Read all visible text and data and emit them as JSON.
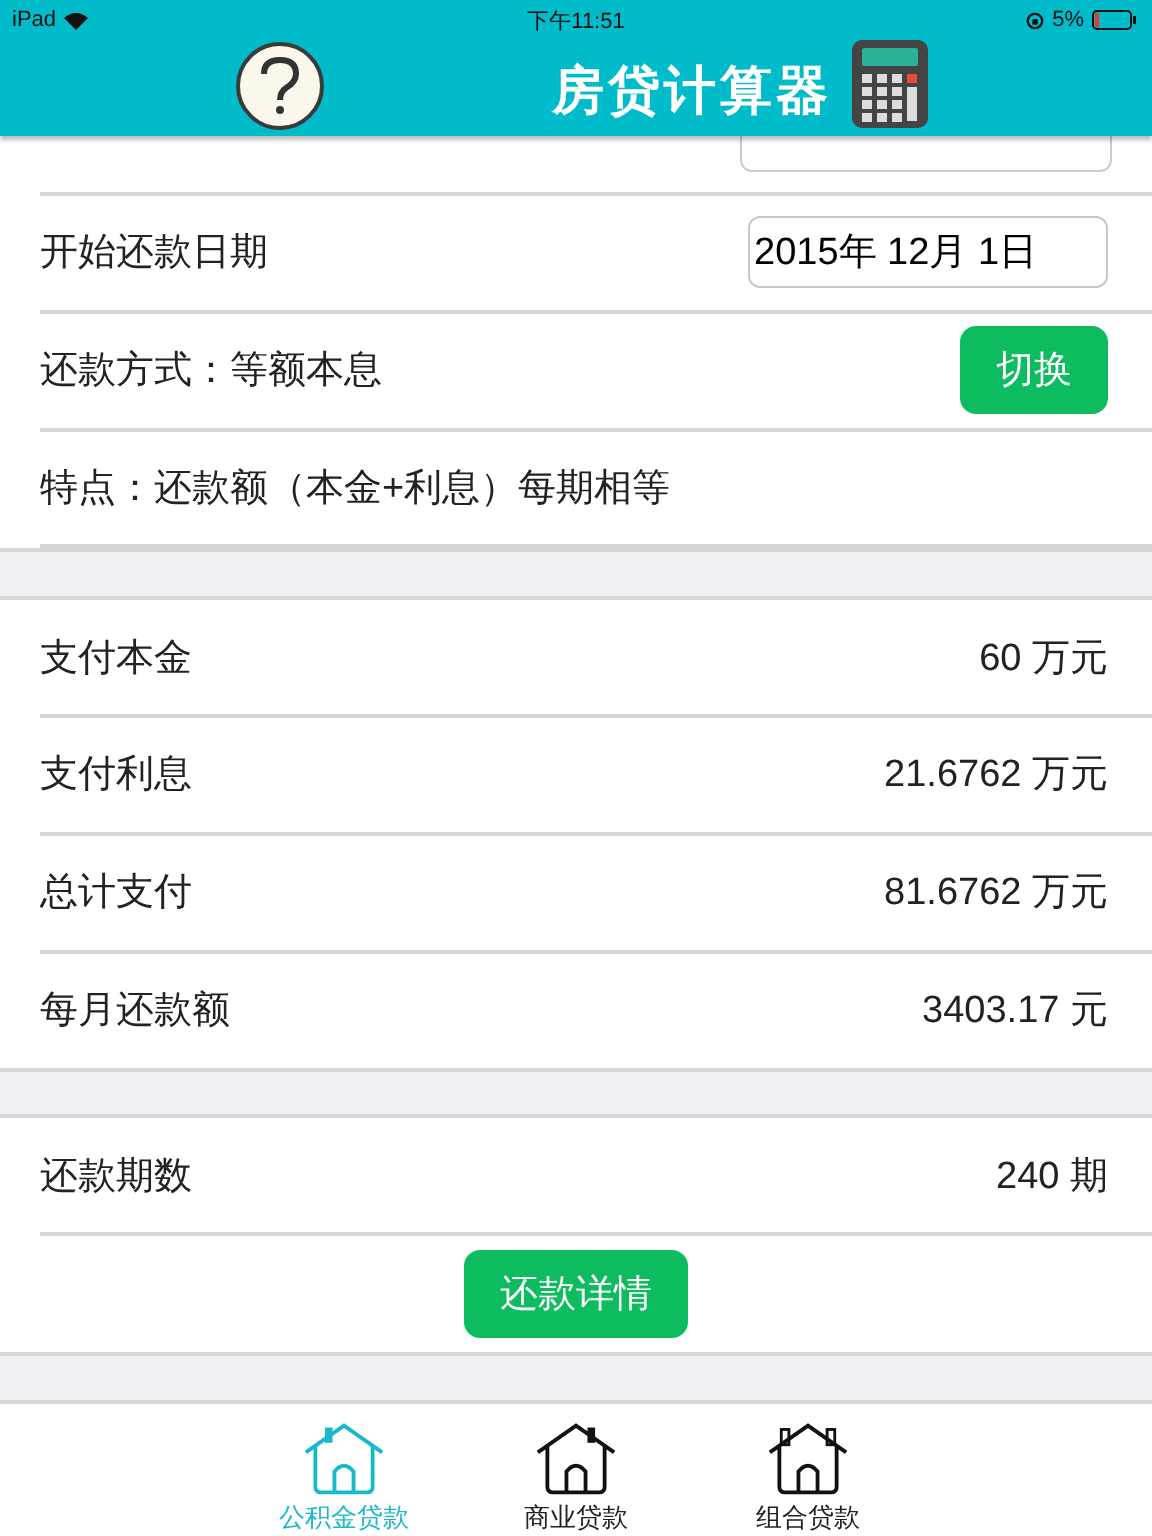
{
  "status_bar": {
    "device": "iPad",
    "time": "下午11:51",
    "battery": "5%"
  },
  "header": {
    "title": "房贷计算器"
  },
  "settings": [
    {
      "kind": "field",
      "label": "开始还款日期",
      "value": "2015年 12月 1日"
    },
    {
      "kind": "button",
      "label": "还款方式：等额本息",
      "button": "切换"
    },
    {
      "kind": "text",
      "label": "特点：还款额（本金+利息）每期相等"
    }
  ],
  "results": [
    {
      "label": "支付本金",
      "value": "60 万元"
    },
    {
      "label": "支付利息",
      "value": "21.6762 万元"
    },
    {
      "label": "总计支付",
      "value": "81.6762 万元"
    },
    {
      "label": "每月还款额",
      "value": "3403.17 元"
    }
  ],
  "periods": {
    "label": "还款期数",
    "value": "240 期",
    "button": "还款详情"
  },
  "tab_bar": [
    {
      "label": "公积金贷款",
      "selected": true
    },
    {
      "label": "商业贷款",
      "selected": false
    },
    {
      "label": "组合贷款",
      "selected": false
    }
  ]
}
